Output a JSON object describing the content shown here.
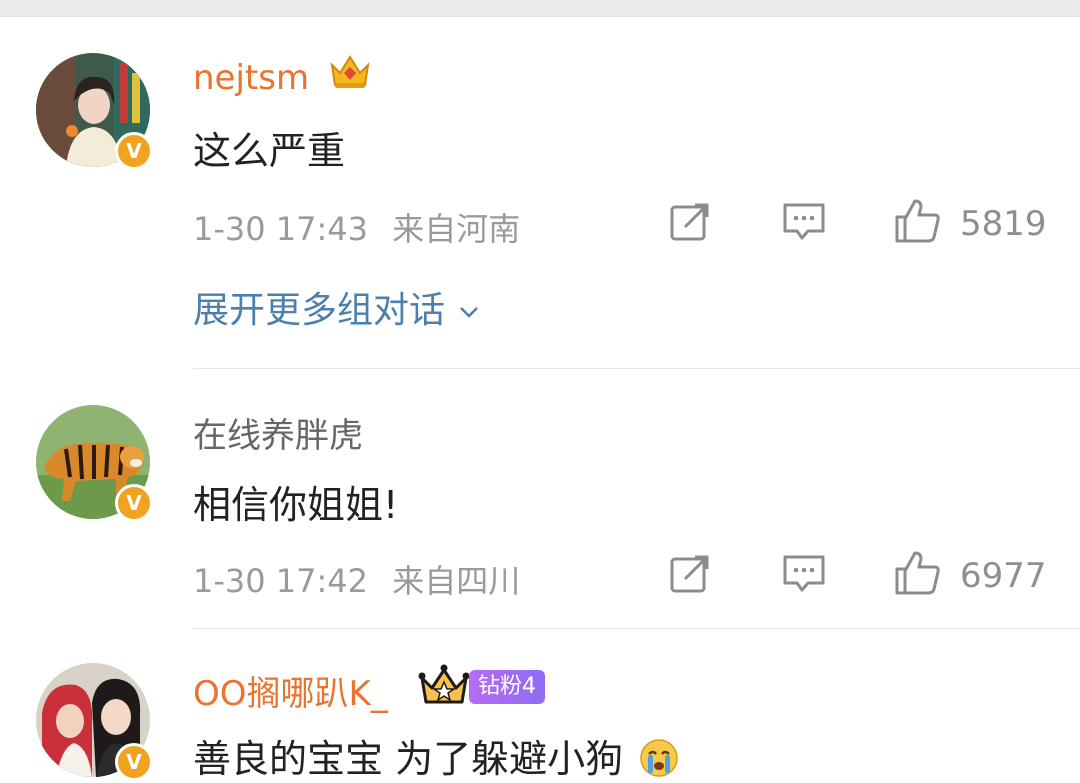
{
  "comments": [
    {
      "username": "nejtsm",
      "text": "这么严重",
      "time": "1-30 17:43",
      "location": "来自河南",
      "likes": "5819",
      "expand_label": "展开更多组对话"
    },
    {
      "username": "在线养胖虎",
      "text": "相信你姐姐!",
      "time": "1-30 17:42",
      "location": "来自四川",
      "likes": "6977"
    },
    {
      "username": "OO搁哪趴K_",
      "fan_badge": "钻粉4",
      "text": "善良的宝宝 为了躲避小狗"
    }
  ],
  "verified_badge": "V",
  "colors": {
    "vip_name": "#e8742f",
    "link": "#4a7fae",
    "verified": "#f0a320",
    "fan_badge": "#a76cf2"
  }
}
